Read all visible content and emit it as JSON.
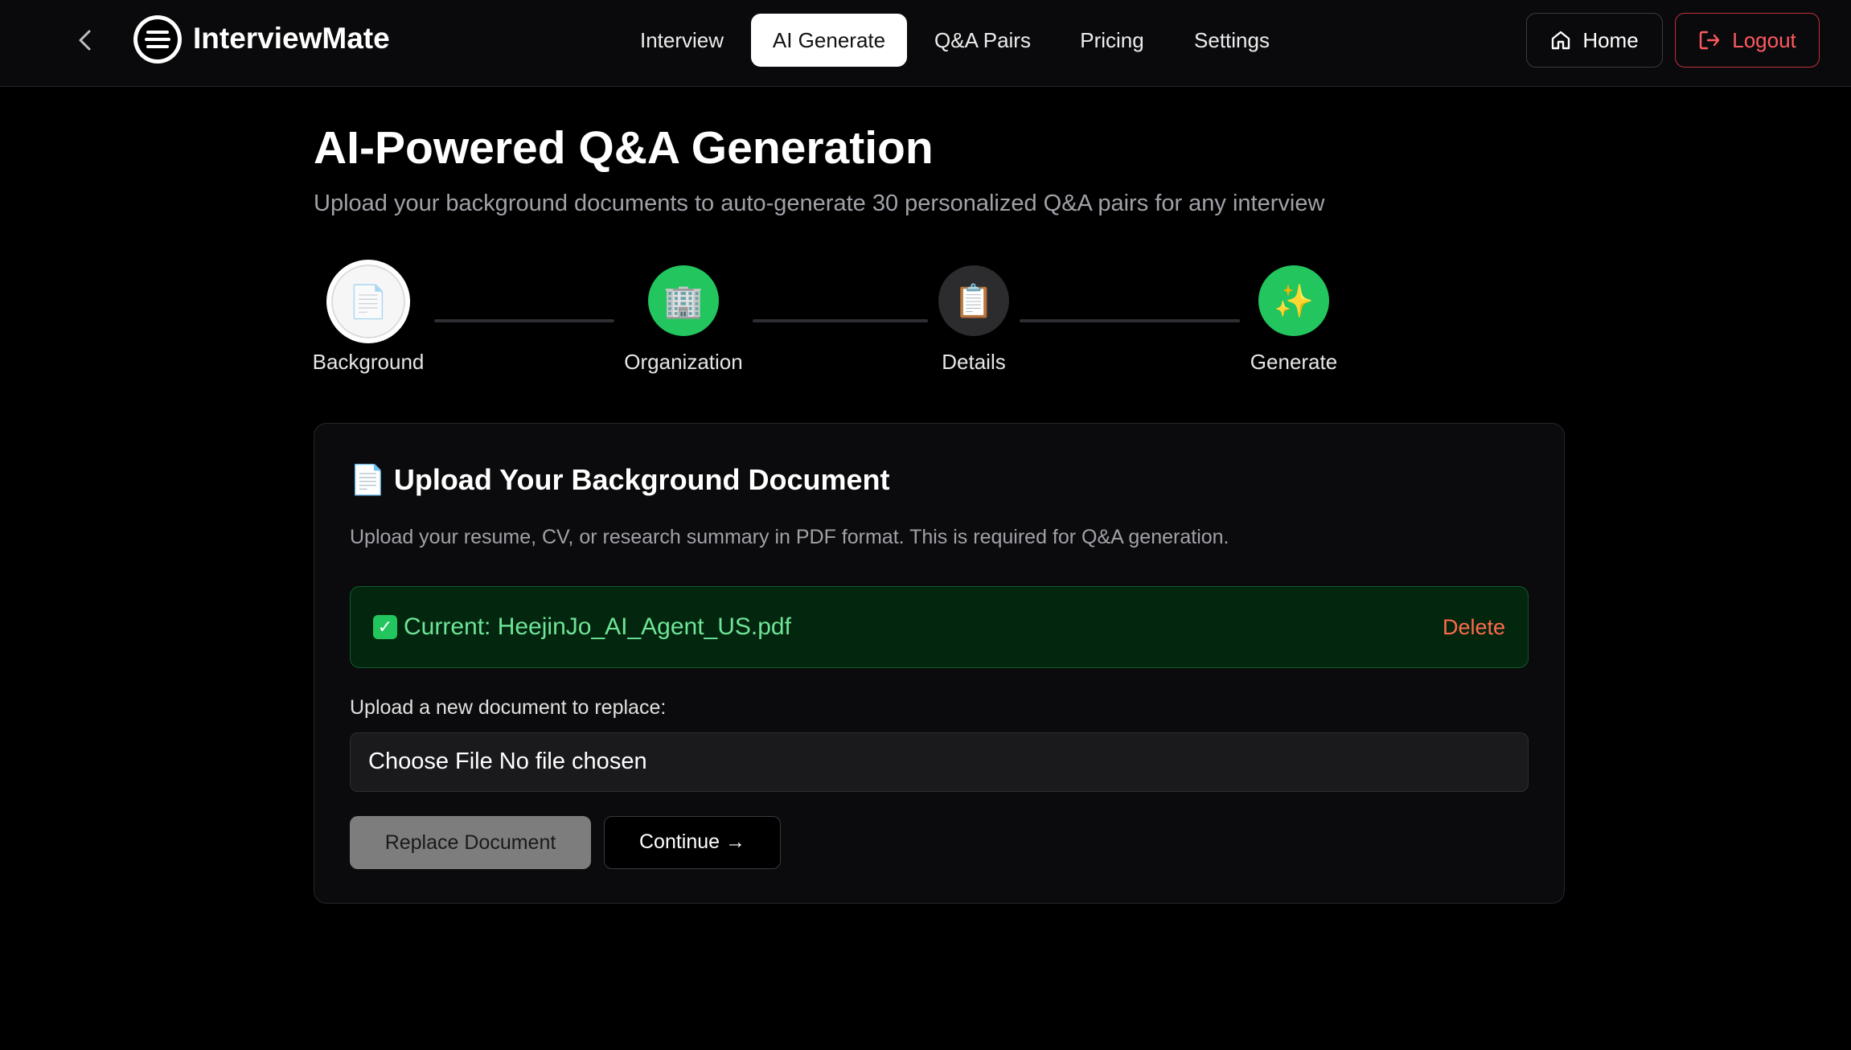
{
  "header": {
    "brand": "InterviewMate",
    "nav": [
      {
        "label": "Interview",
        "active": false
      },
      {
        "label": "AI Generate",
        "active": true
      },
      {
        "label": "Q&A Pairs",
        "active": false
      },
      {
        "label": "Pricing",
        "active": false
      },
      {
        "label": "Settings",
        "active": false
      }
    ],
    "home_label": "Home",
    "logout_label": "Logout"
  },
  "page": {
    "title": "AI-Powered Q&A Generation",
    "subtitle": "Upload your background documents to auto-generate 30 personalized Q&A pairs for any interview"
  },
  "steps": [
    {
      "label": "Background",
      "icon": "📄",
      "state": "current"
    },
    {
      "label": "Organization",
      "icon": "🏢",
      "state": "complete"
    },
    {
      "label": "Details",
      "icon": "📋",
      "state": "pending"
    },
    {
      "label": "Generate",
      "icon": "✨",
      "state": "complete"
    }
  ],
  "card": {
    "title_icon": "📄",
    "title": "Upload Your Background Document",
    "description": "Upload your resume, CV, or research summary in PDF format. This is required for Q&A generation.",
    "current_file_text": "Current: HeejinJo_AI_Agent_US.pdf",
    "delete_label": "Delete",
    "replace_prompt": "Upload a new document to replace:",
    "file_input_text": "Choose File No file chosen",
    "replace_button": "Replace Document",
    "continue_button": "Continue →"
  },
  "colors": {
    "accent_green": "#22c55e",
    "logout_red": "#ff5a5f",
    "delete_red": "#ff6b4a",
    "success_text": "#6ee597"
  }
}
